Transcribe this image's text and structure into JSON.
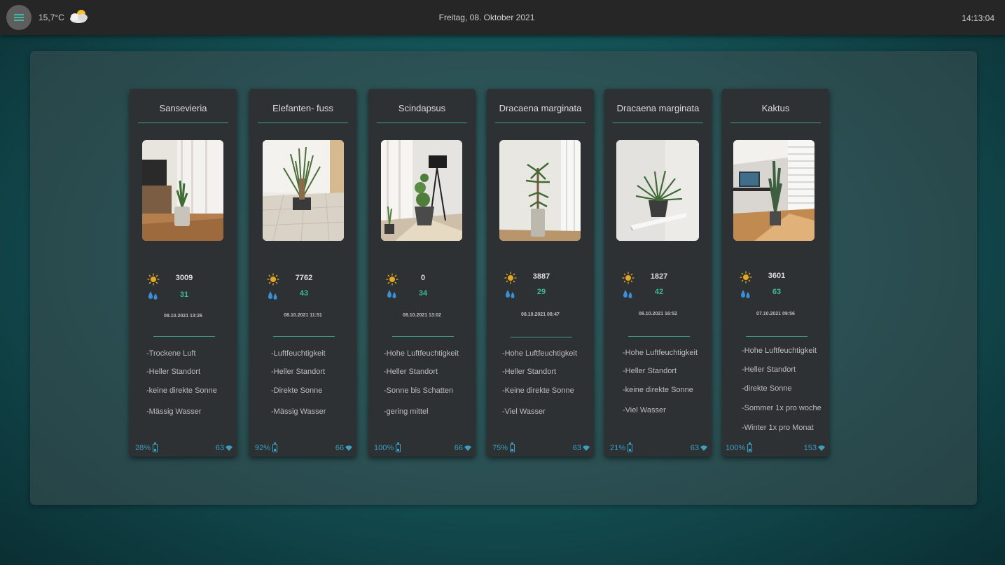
{
  "topbar": {
    "temperature": "15,7°C",
    "weather_icon": "partly-cloudy-icon",
    "date": "Freitag, 08. Oktober 2021",
    "time": "14:13:04",
    "accent": "#3fb8a4"
  },
  "plants": [
    {
      "name": "Sansevieria",
      "light": "3009",
      "moisture": "31",
      "timestamp": "08.10.2021 13:26",
      "tips": [
        "-Trockene Luft",
        "-Heller Standort",
        "-keine direkte Sonne",
        "-Mässig Wasser"
      ],
      "battery": "28%",
      "signal": "63"
    },
    {
      "name": "Elefanten- fuss",
      "light": "7762",
      "moisture": "43",
      "timestamp": "08.10.2021 11:51",
      "tips": [
        "-Luftfeuchtigkeit",
        "-Heller Standort",
        "-Direkte Sonne",
        "-Mässig Wasser"
      ],
      "battery": "92%",
      "signal": "66"
    },
    {
      "name": "Scindapsus",
      "light": "0",
      "moisture": "34",
      "timestamp": "08.10.2021 13:02",
      "tips": [
        "-Hohe Luftfeuchtigkeit",
        "-Heller Standort",
        "-Sonne bis Schatten",
        "-gering mittel"
      ],
      "battery": "100%",
      "signal": "66"
    },
    {
      "name": "Dracaena marginata",
      "light": "3887",
      "moisture": "29",
      "timestamp": "08.10.2021 08:47",
      "tips": [
        "-Hohe Luftfeuchtigkeit",
        "-Heller Standort",
        "-Keine direkte Sonne",
        "-Viel Wasser"
      ],
      "battery": "75%",
      "signal": "63"
    },
    {
      "name": "Dracaena marginata",
      "light": "1827",
      "moisture": "42",
      "timestamp": "06.10.2021 16:52",
      "tips": [
        "-Hohe Luftfeuchtigkeit",
        "-Heller Standort",
        "-keine direkte Sonne",
        "-Viel Wasser"
      ],
      "battery": "21%",
      "signal": "63"
    },
    {
      "name": "Kaktus",
      "light": "3601",
      "moisture": "63",
      "timestamp": "07.10.2021 09:56",
      "tips": [
        "-Hohe Luftfeuchtigkeit",
        "-Heller Standort",
        "-direkte Sonne",
        "-Sommer 1x pro woche",
        "-Winter 1x pro Monat"
      ],
      "battery": "100%",
      "signal": "153"
    }
  ]
}
